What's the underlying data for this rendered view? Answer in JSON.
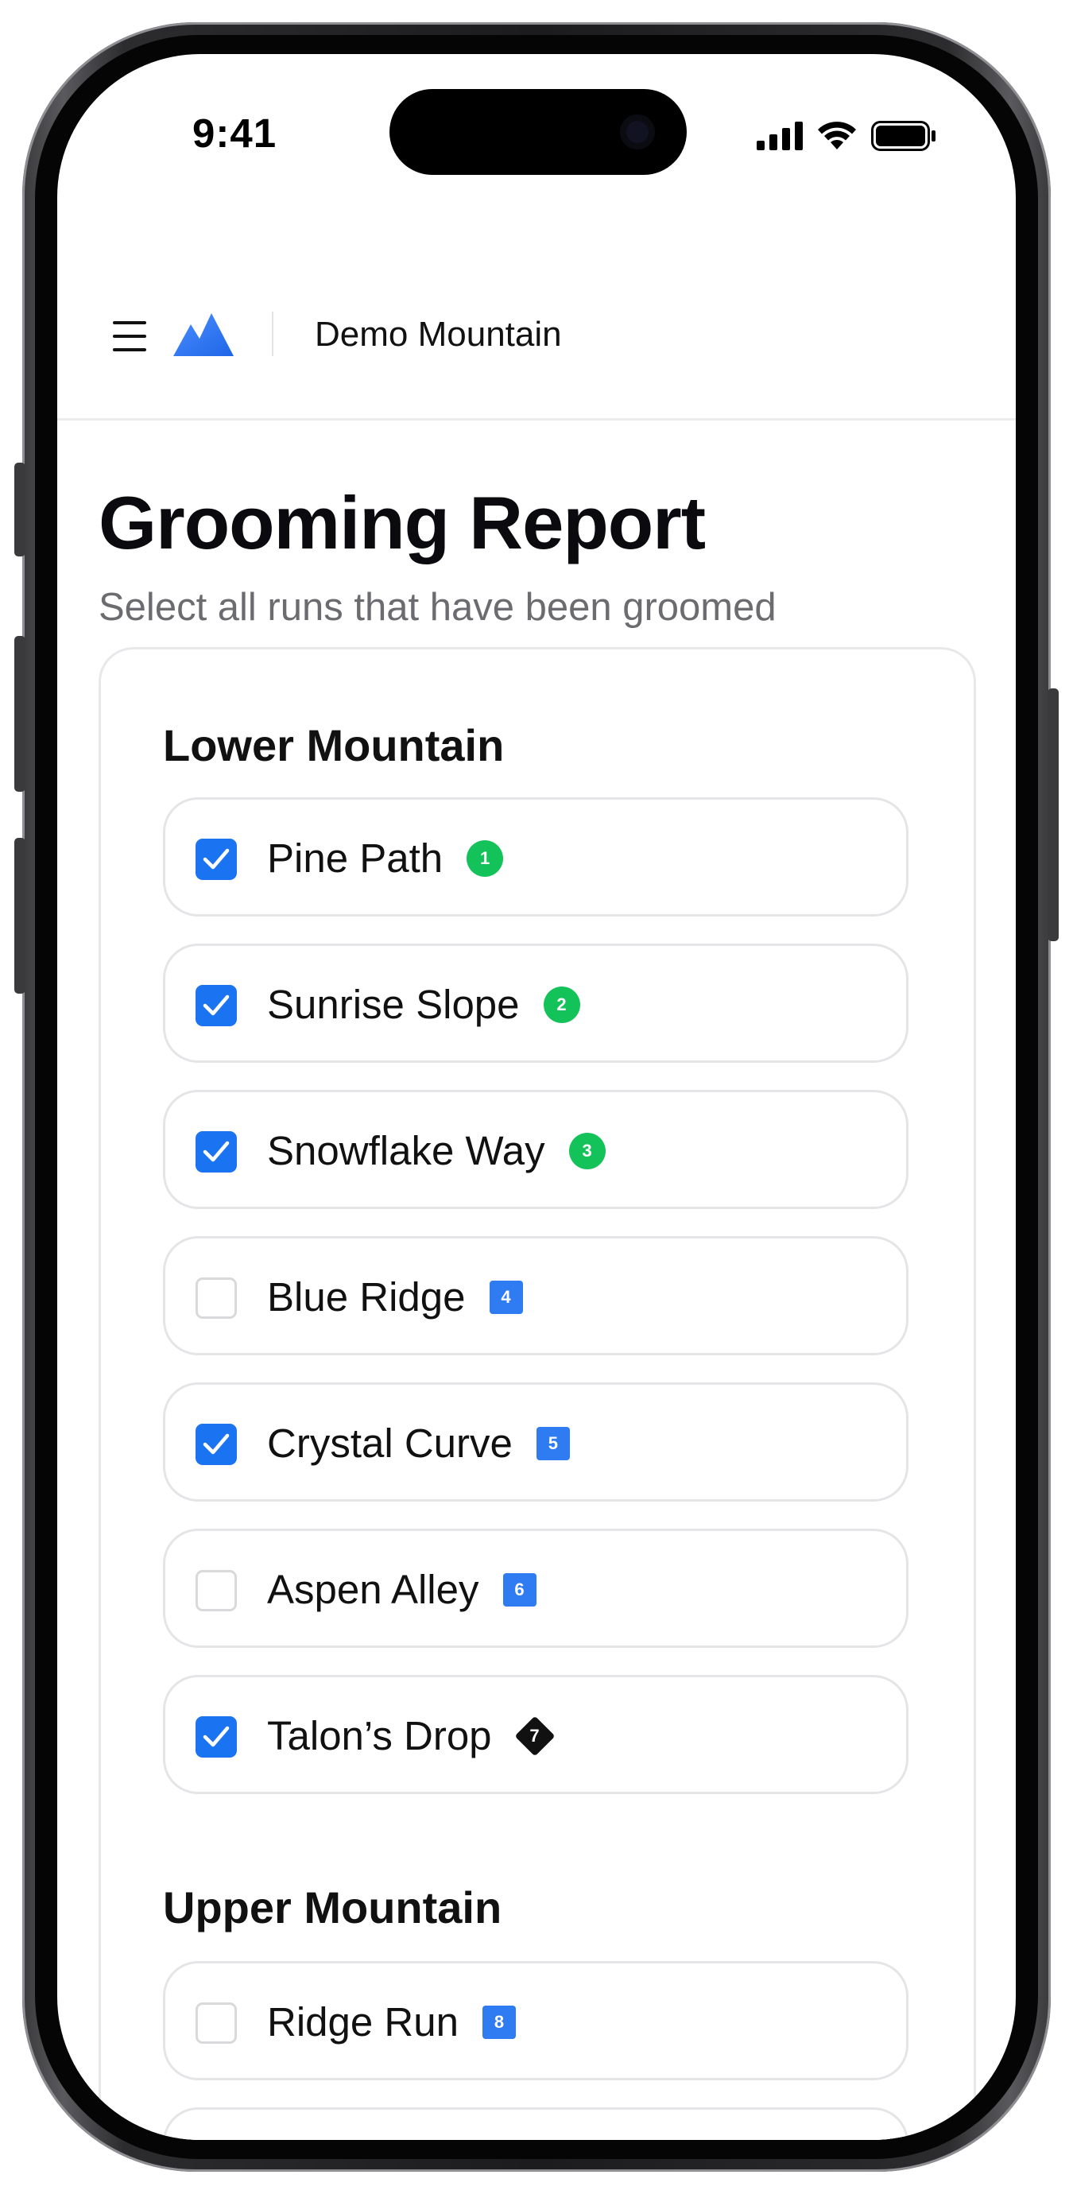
{
  "status_bar": {
    "time": "9:41"
  },
  "header": {
    "app_name": "Demo Mountain",
    "logo_color": "#2f7bf2"
  },
  "page": {
    "title": "Grooming Report",
    "subtitle": "Select all runs that have been groomed"
  },
  "sections": [
    {
      "title": "Lower Mountain",
      "runs": [
        {
          "name": "Pine Path",
          "number": "1",
          "difficulty": "green",
          "groomed": true
        },
        {
          "name": "Sunrise Slope",
          "number": "2",
          "difficulty": "green",
          "groomed": true
        },
        {
          "name": "Snowflake Way",
          "number": "3",
          "difficulty": "green",
          "groomed": true
        },
        {
          "name": "Blue Ridge",
          "number": "4",
          "difficulty": "blue",
          "groomed": false
        },
        {
          "name": "Crystal Curve",
          "number": "5",
          "difficulty": "blue",
          "groomed": true
        },
        {
          "name": "Aspen Alley",
          "number": "6",
          "difficulty": "blue",
          "groomed": false
        },
        {
          "name": "Talon’s Drop",
          "number": "7",
          "difficulty": "black",
          "groomed": true
        }
      ]
    },
    {
      "title": "Upper Mountain",
      "runs": [
        {
          "name": "Ridge Run",
          "number": "8",
          "difficulty": "blue",
          "groomed": false
        }
      ]
    }
  ],
  "colors": {
    "checkbox_checked": "#1a73f0",
    "green_badge": "#14c25a",
    "blue_badge": "#2f7bf2",
    "black_badge": "#111111"
  }
}
